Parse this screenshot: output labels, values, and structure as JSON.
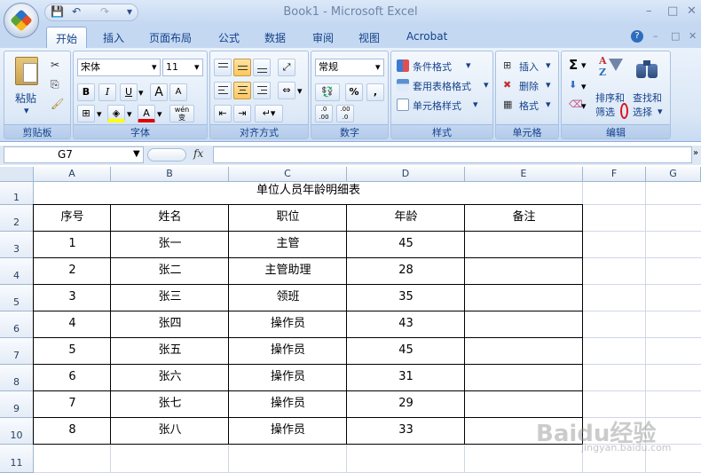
{
  "window": {
    "title": "Book1 - Microsoft Excel",
    "minimize": "–",
    "restore": "□",
    "close": "✕"
  },
  "qat": {
    "save": "💾",
    "undo": "↶",
    "redo": "↷",
    "more": "▾"
  },
  "tabs": [
    "开始",
    "插入",
    "页面布局",
    "公式",
    "数据",
    "审阅",
    "视图",
    "Acrobat"
  ],
  "ribbon": {
    "clipboard": {
      "label": "剪贴板",
      "paste": "粘贴"
    },
    "font": {
      "label": "字体",
      "name": "宋体",
      "size": "11",
      "bold": "B",
      "italic": "I",
      "underline": "U",
      "grow": "A",
      "shrink": "A",
      "color_a": "A",
      "pinyin": "wén 变"
    },
    "align": {
      "label": "对齐方式"
    },
    "number": {
      "label": "数字",
      "format": "常规",
      "percent": "%",
      "comma": ",",
      "inc": ".0 .00",
      "dec": ".00 .0"
    },
    "styles": {
      "label": "样式",
      "cond": "条件格式",
      "table": "套用表格格式",
      "cell": "单元格样式"
    },
    "cells": {
      "label": "单元格",
      "insert": "插入",
      "delete": "删除",
      "format": "格式"
    },
    "editing": {
      "label": "编辑",
      "sigma": "Σ",
      "sort1": "排序和",
      "sort2": "筛选",
      "find1": "查找和",
      "find2": "选择"
    }
  },
  "formula_bar": {
    "name_box": "G7",
    "fx": "fx",
    "value": ""
  },
  "columns": [
    "A",
    "B",
    "C",
    "D",
    "E",
    "F",
    "G"
  ],
  "rows": [
    "1",
    "2",
    "3",
    "4",
    "5",
    "6",
    "7",
    "8",
    "9",
    "10",
    "11"
  ],
  "sheet": {
    "title": "单位人员年龄明细表",
    "headers": [
      "序号",
      "姓名",
      "职位",
      "年龄",
      "备注"
    ],
    "data": [
      [
        "1",
        "张一",
        "主管",
        "45",
        ""
      ],
      [
        "2",
        "张二",
        "主管助理",
        "28",
        ""
      ],
      [
        "3",
        "张三",
        "领班",
        "35",
        ""
      ],
      [
        "4",
        "张四",
        "操作员",
        "43",
        ""
      ],
      [
        "5",
        "张五",
        "操作员",
        "45",
        ""
      ],
      [
        "6",
        "张六",
        "操作员",
        "31",
        ""
      ],
      [
        "7",
        "张七",
        "操作员",
        "29",
        ""
      ],
      [
        "8",
        "张八",
        "操作员",
        "33",
        ""
      ]
    ]
  },
  "watermark": {
    "main": "Baidu经验",
    "sub": "jingyan.baidu.com"
  }
}
